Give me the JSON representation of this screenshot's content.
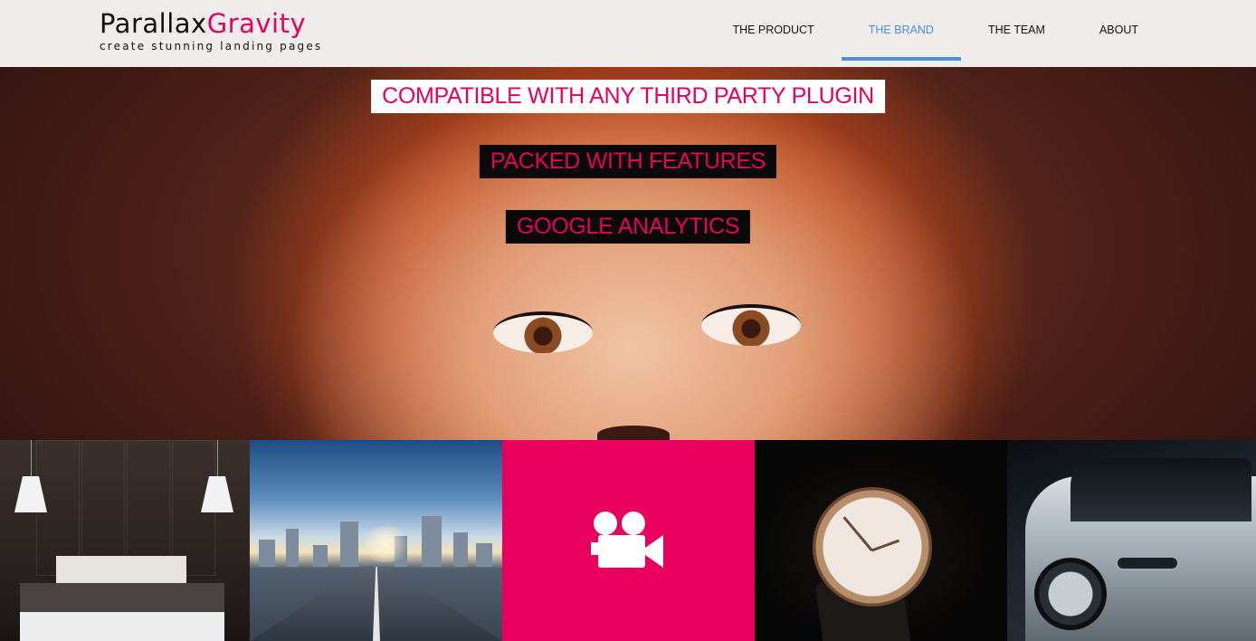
{
  "header": {
    "logo": {
      "title_part1": "Parallax",
      "title_part2": "Gravity",
      "tagline": "create stunning landing pages"
    },
    "nav": [
      {
        "label": "THE PRODUCT",
        "active": false
      },
      {
        "label": "THE BRAND",
        "active": true
      },
      {
        "label": "THE TEAM",
        "active": false
      },
      {
        "label": "ABOUT",
        "active": false
      }
    ]
  },
  "hero": {
    "labels": [
      "COMPATIBLE WITH ANY THIRD PARTY PLUGIN",
      "PACKED WITH FEATURES",
      "GOOGLE ANALYTICS"
    ]
  },
  "tiles": [
    {
      "name": "bedroom-image"
    },
    {
      "name": "city-road-image"
    },
    {
      "name": "video-camera-tile",
      "icon": "video-camera-icon"
    },
    {
      "name": "watch-image"
    },
    {
      "name": "car-image"
    }
  ],
  "colors": {
    "brand_pink": "#e8005e",
    "nav_active": "#4a8fe0",
    "header_bg": "#efedec"
  }
}
